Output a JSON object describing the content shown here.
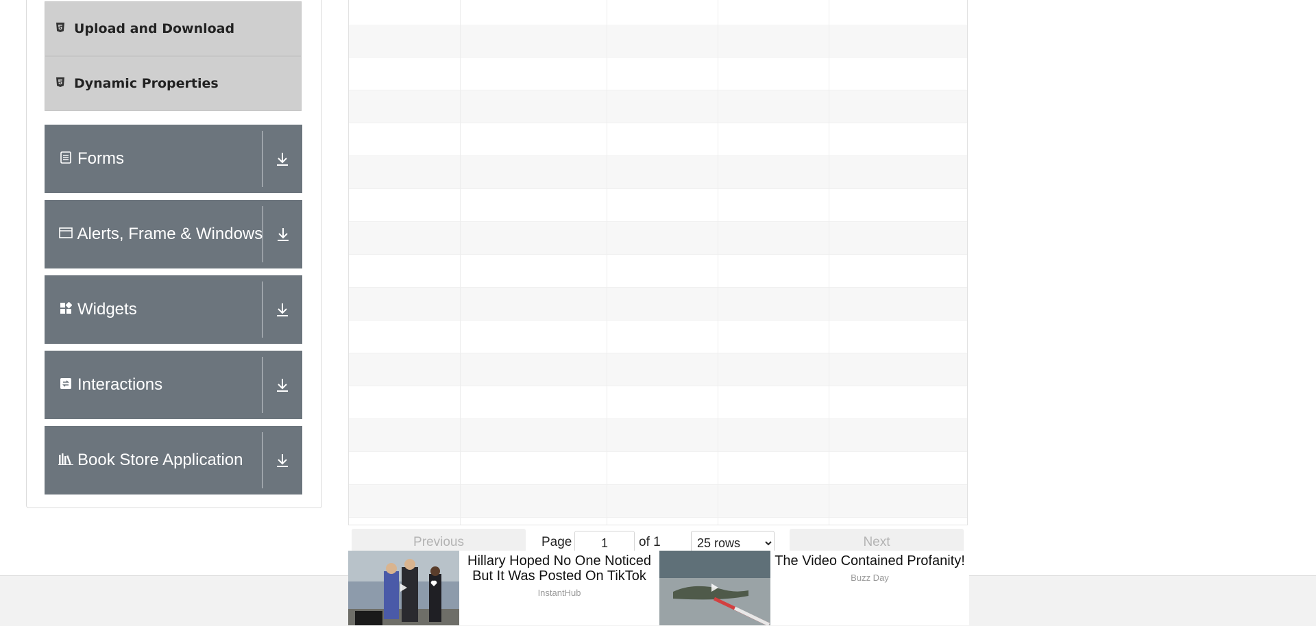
{
  "sidebar": {
    "sub_items": [
      {
        "label": "Upload and Download",
        "icon": "html5-icon"
      },
      {
        "label": "Dynamic Properties",
        "icon": "html5-icon"
      }
    ],
    "groups": [
      {
        "label": "Forms",
        "icon": "form-icon"
      },
      {
        "label": "Alerts, Frame & Windows",
        "icon": "window-icon"
      },
      {
        "label": "Widgets",
        "icon": "widgets-icon"
      },
      {
        "label": "Interactions",
        "icon": "interactions-icon"
      },
      {
        "label": "Book Store Application",
        "icon": "books-icon"
      }
    ]
  },
  "pagination": {
    "previous_label": "Previous",
    "page_label": "Page",
    "page_value": "1",
    "of_label": "of 1",
    "rows_selected": "25 rows",
    "next_label": "Next"
  },
  "ads": [
    {
      "title": "Hillary Hoped No One Noticed But It Was Posted On TikTok",
      "source": "InstantHub"
    },
    {
      "title": "The Video Contained Profanity!",
      "source": "Buzz Day"
    }
  ]
}
